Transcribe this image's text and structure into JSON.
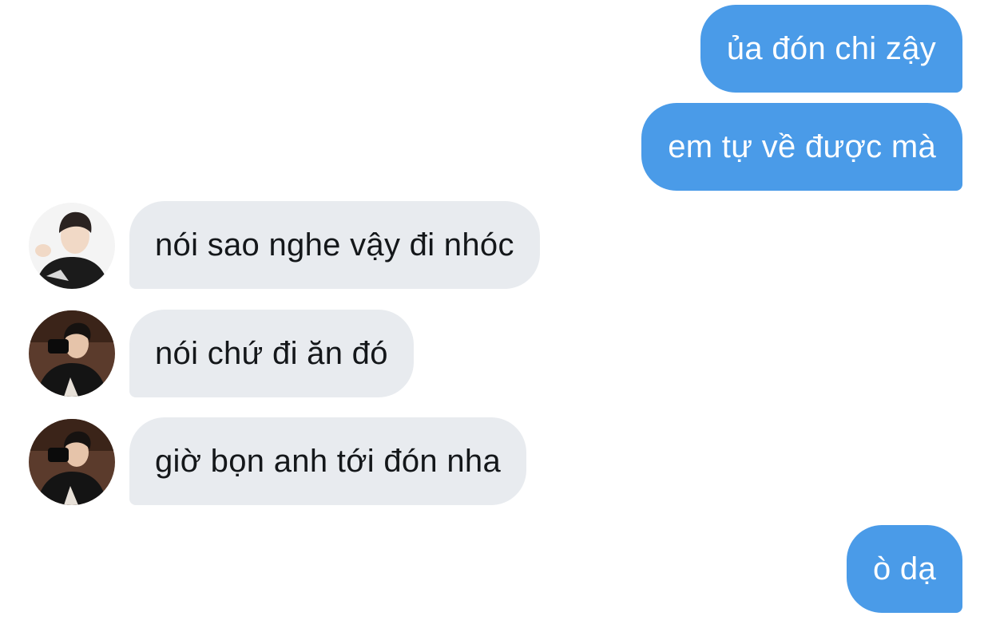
{
  "conversation": {
    "messages": [
      {
        "sender": "me",
        "text": "ủa đón chi zậy"
      },
      {
        "sender": "me",
        "text": "em tự về được mà"
      },
      {
        "sender": "other",
        "avatar": "person-avatar-icon",
        "text": "nói sao nghe vậy đi nhóc"
      },
      {
        "sender": "other",
        "avatar": "person-avatar-icon",
        "text": "nói chứ đi ăn đó"
      },
      {
        "sender": "other",
        "avatar": "person-avatar-icon",
        "text": "giờ bọn anh tới đón nha"
      },
      {
        "sender": "me",
        "text": "ò dạ"
      }
    ]
  },
  "colors": {
    "sent_bubble": "#4a9be8",
    "received_bubble": "#e8ebef",
    "sent_text": "#ffffff",
    "received_text": "#14171a"
  }
}
